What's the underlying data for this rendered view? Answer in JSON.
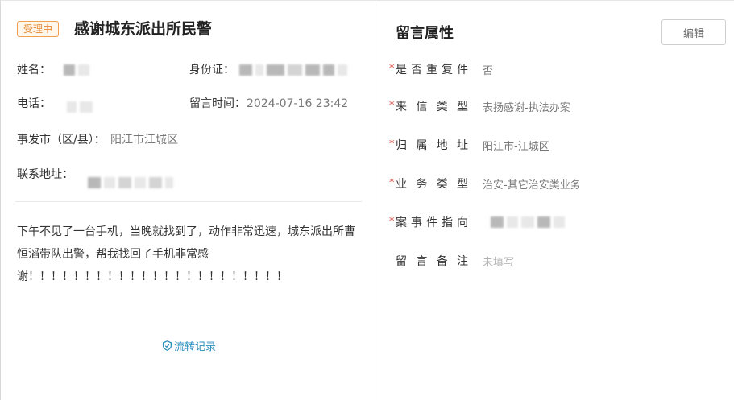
{
  "header": {
    "status_badge": "受理中",
    "title": "感谢城东派出所民警"
  },
  "fields": {
    "name_label": "姓名：",
    "id_label": "身份证：",
    "phone_label": "电话：",
    "time_label": "留言时间：",
    "time_value": "2024-07-16 23:42",
    "district_label": "事发市（区/县）：",
    "district_value": "阳江市江城区",
    "address_label": "联系地址："
  },
  "message": {
    "content": "下午不见了一台手机，当晚就找到了，动作非常迅速，城东派出所曹恒滔带队出警，帮我找回了手机非常感谢！！！！！！！！！！！！！！！！！！！！！！！"
  },
  "flow_link": "流转记录",
  "attributes": {
    "section_title": "留言属性",
    "edit_label": "编辑",
    "rows": [
      {
        "label": "是否重复件",
        "value": "否",
        "required": true
      },
      {
        "label": "来信类型",
        "value": "表扬感谢-执法办案",
        "required": true
      },
      {
        "label": "归属地址",
        "value": "阳江市-江城区",
        "required": true
      },
      {
        "label": "业务类型",
        "value": "治安-其它治安类业务",
        "required": true
      },
      {
        "label": "案事件指向",
        "value": "",
        "required": true
      },
      {
        "label": "留言备注",
        "value": "未填写",
        "required": false
      }
    ]
  },
  "icons": {
    "flow": "shield-check-icon"
  },
  "colors": {
    "badge": "#e8892f",
    "link": "#2a8fbd",
    "required": "#e23c3c"
  }
}
